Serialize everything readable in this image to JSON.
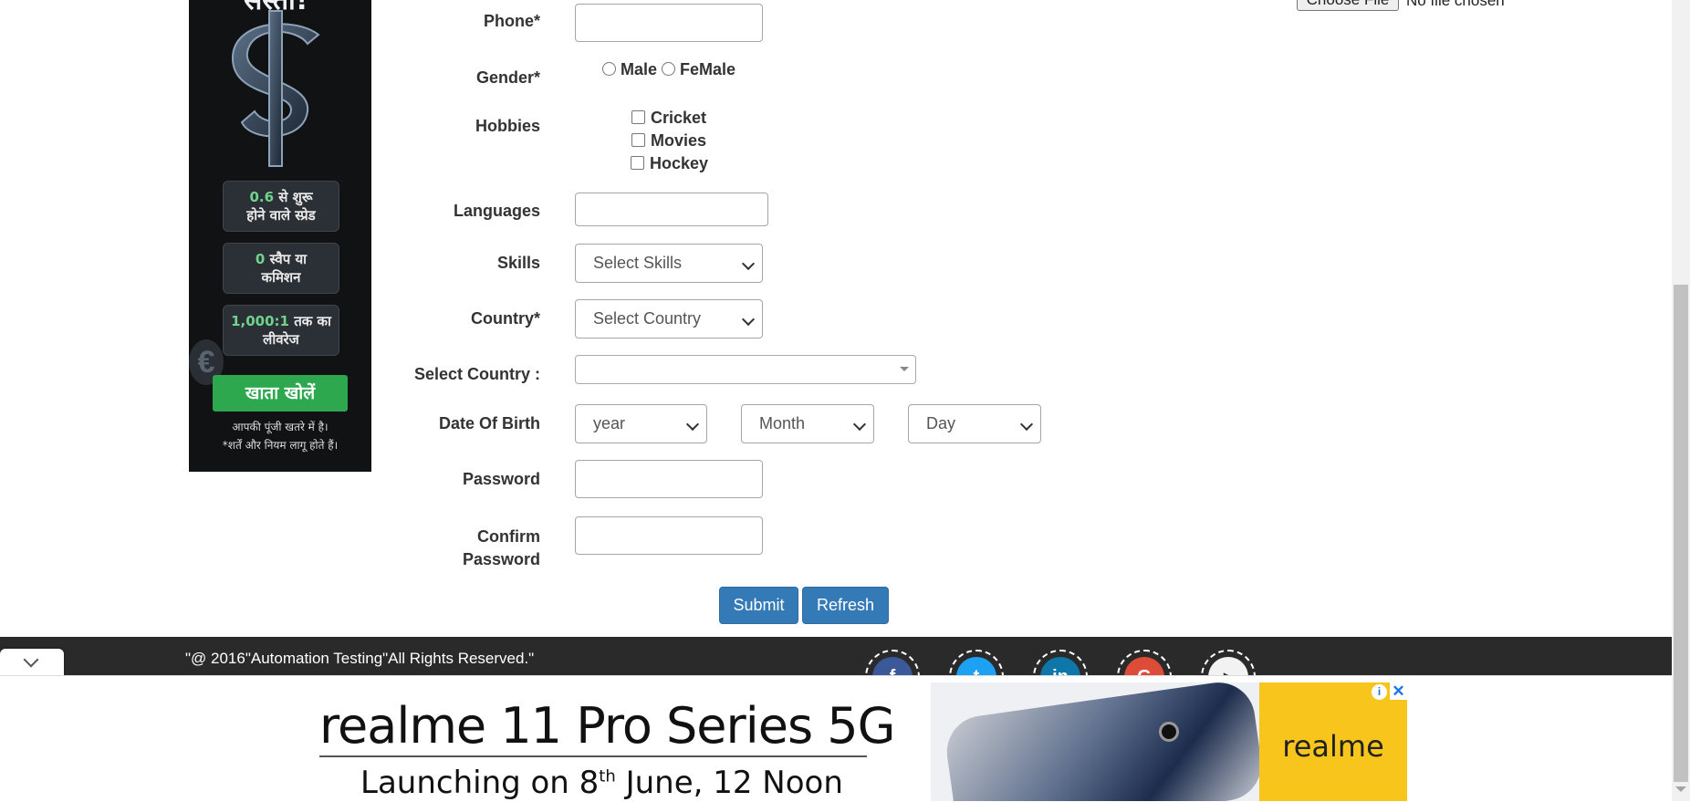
{
  "left_ad": {
    "top_word": "सस्ता!",
    "box1_num": "0.6",
    "box1_text1": " से शुरू",
    "box1_text2": "होने वाले स्प्रेड",
    "box2_num": "0",
    "box2_text1": " स्वैप या",
    "box2_text2": "कमिशन",
    "box3_num": "1,000:1",
    "box3_text1": " तक का",
    "box3_text2": "लीवरेज",
    "cta": "खाता खोलें",
    "note1": "आपकी पूंजी खतरे में है।",
    "note2": "*शर्तें और नियम लागू होते हैं।"
  },
  "file_upload": {
    "button": "Choose File",
    "status": "No file chosen"
  },
  "form": {
    "phone_label": "Phone*",
    "gender_label": "Gender*",
    "gender_options": [
      "Male",
      "FeMale"
    ],
    "hobbies_label": "Hobbies",
    "hobbies": [
      "Cricket",
      "Movies",
      "Hockey"
    ],
    "languages_label": "Languages",
    "skills_label": "Skills",
    "skills_placeholder": "Select Skills",
    "country_label": "Country*",
    "country_placeholder": "Select Country",
    "select_country_label": "Select Country :",
    "dob_label": "Date Of Birth",
    "dob_year": "year",
    "dob_month": "Month",
    "dob_day": "Day",
    "password_label": "Password",
    "confirm_label_1": "Confirm",
    "confirm_label_2": "Password",
    "submit": "Submit",
    "refresh": "Refresh"
  },
  "footer": {
    "copyright": "\"@ 2016\"Automation Testing\"All Rights Reserved.\"",
    "social_icons": [
      "facebook-icon",
      "twitter-icon",
      "linkedin-icon",
      "google-plus-icon",
      "youtube-icon"
    ]
  },
  "bottom_ad": {
    "headline": "realme 11 Pro Series 5G",
    "sub_pre": "Launching on 8",
    "sub_sup": "th",
    "sub_post": " June, 12 Noon",
    "brand": "realme",
    "info_glyph": "i",
    "close_glyph": "✕"
  },
  "colors": {
    "button_blue": "#337ab7",
    "footer_bg": "#2a2a2a",
    "ad_green": "#2ea84f",
    "ad_yellow": "#f8c51c"
  }
}
